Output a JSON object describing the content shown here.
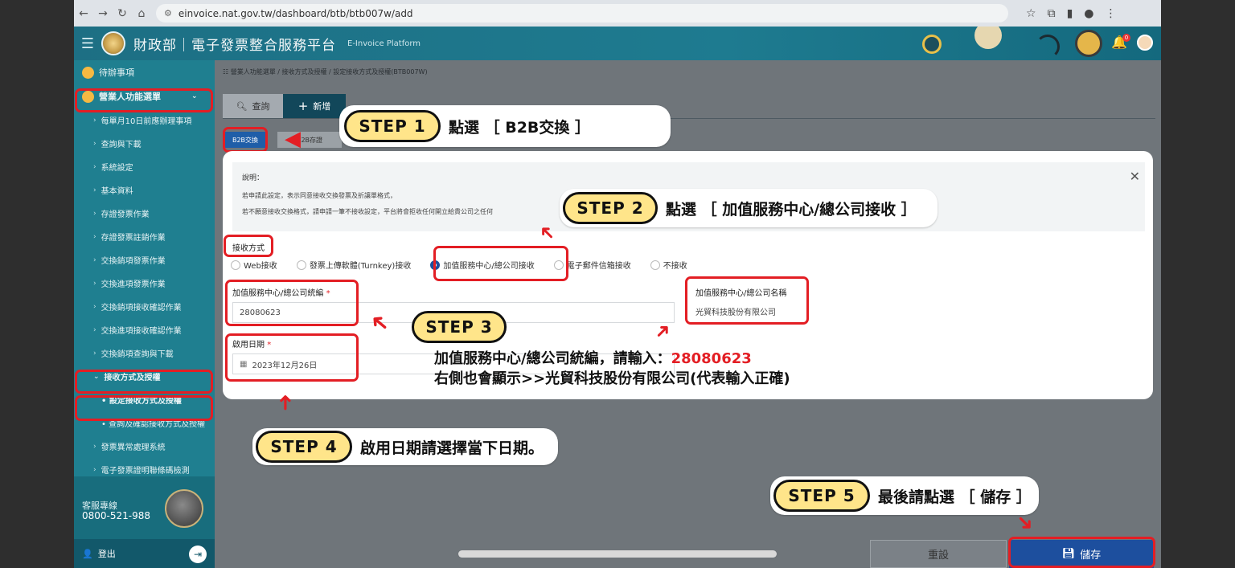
{
  "browser": {
    "url": "einvoice.nat.gov.tw/dashboard/btb/btb007w/add"
  },
  "header": {
    "title": "財政部｜電子發票整合服務平台",
    "subtitle": "E-Invoice Platform",
    "notification_count": "0"
  },
  "sidebar": {
    "todo": "待辦事項",
    "menu": "營業人功能選單",
    "items": [
      "每單月10日前應辦理事項",
      "查詢與下載",
      "系統設定",
      "基本資料",
      "存證發票作業",
      "存證發票註銷作業",
      "交換銷項發票作業",
      "交換進項發票作業",
      "交換銷項接收確認作業",
      "交換進項接收確認作業",
      "交換銷項查詢與下載"
    ],
    "expanded": "接收方式及授權",
    "sub_active": "• 設定接收方式及授權",
    "sub_other": "• 查詢及確認接收方式及授權",
    "more_items": [
      "發票異常處理系統",
      "電子發票證明聯條碼檢測"
    ],
    "hotline_label": "客服專線",
    "hotline": "0800-521-988",
    "logout": "登出"
  },
  "main": {
    "breadcrumb": "營業人功能選單 / 接收方式及授權 / 設定接收方式及授權(BTB007W)",
    "tab_query": "查詢",
    "tab_add": "新增",
    "subtab_b2b": "B2B交換",
    "subtab_2": "B2B存證"
  },
  "modal": {
    "desc_title": "說明：",
    "desc_1": "若申請此設定，表示同意接收交換發票及折讓單格式，",
    "desc_2": "若不願意接收交換格式，請申請一筆不接收設定，平台將會拒收任何開立給貴公司之任何",
    "receive_label": "接收方式",
    "options": [
      "Web接收",
      "發票上傳軟體(Turnkey)接收",
      "加值服務中心/總公司接收",
      "電子郵件信箱接收",
      "不接收"
    ],
    "tax_id_label": "加值服務中心/總公司統編",
    "tax_id_value": "28080623",
    "name_label": "加值服務中心/總公司名稱",
    "name_value": "光貿科技股份有限公司",
    "date_label": "啟用日期",
    "date_value": "2023年12月26日"
  },
  "steps": {
    "s1": "STEP  1",
    "s1_text": "點選 ［ B2B交換 ］",
    "s2": "STEP  2",
    "s2_text": "點選 ［ 加值服務中心/總公司接收 ］",
    "s3": "STEP  3",
    "s3_line1a": "加值服務中心/總公司統編，請輸入：",
    "s3_line1b": "28080623",
    "s3_line2": "右側也會顯示>>光貿科技股份有限公司(代表輸入正確)",
    "s4": "STEP  4",
    "s4_text": "啟用日期請選擇當下日期。",
    "s5": "STEP  5",
    "s5_text": "最後請點選 ［ 儲存 ］"
  },
  "buttons": {
    "reset": "重設",
    "save": "儲存"
  }
}
